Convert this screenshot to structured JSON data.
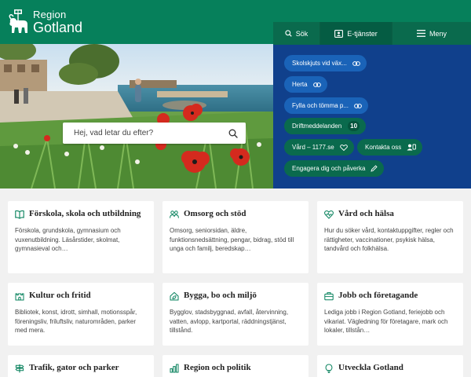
{
  "header": {
    "logo_line1": "Region",
    "logo_line2": "Gotland"
  },
  "nav": {
    "search_label": "Sök",
    "eservices_label": "E-tjänster",
    "menu_label": "Meny"
  },
  "quicklinks": [
    {
      "label": "Skolskjuts vid väx...",
      "icon": "link-icon"
    },
    {
      "label": "Herta",
      "icon": "link-icon"
    },
    {
      "label": "Fylla och tömma p...",
      "icon": "link-icon"
    },
    {
      "label": "Driftmeddelanden",
      "badge": "10"
    },
    {
      "label": "Vård – 1177.se",
      "icon": "link-icon"
    },
    {
      "label": "Kontakta oss",
      "icon": "contact-icon"
    },
    {
      "label": "Engagera dig och påverka",
      "icon": "pencil-icon"
    }
  ],
  "search": {
    "placeholder": "Hej, vad letar du efter?"
  },
  "cards": [
    {
      "title": "Förskola, skola och utbildning",
      "desc": "Förskola, grundskola, gymnasium och vuxenutbildning. Läsårstider, skolmat, gymnasieval och…",
      "icon": "book-icon"
    },
    {
      "title": "Omsorg och stöd",
      "desc": "Omsorg, seniorsidan, äldre, funktionsnedsättning, pengar, bidrag, stöd till unga och familj, beredskap…",
      "icon": "people-icon"
    },
    {
      "title": "Vård och hälsa",
      "desc": "Hur du söker vård, kontaktuppgifter, regler och rättigheter, vaccinationer, psykisk hälsa, tandvård och folkhälsa.",
      "icon": "heart-pulse-icon"
    },
    {
      "title": "Kultur och fritid",
      "desc": "Bibliotek, konst, idrott, simhall, motionsspår, föreningsliv, friluftsliv, naturområden, parker med mera.",
      "icon": "castle-icon"
    },
    {
      "title": "Bygga, bo och miljö",
      "desc": "Bygglov, stadsbyggnad, avfall, återvinning, vatten, avlopp, kartportal, räddningstjänst, tillstånd.",
      "icon": "house-leaf-icon"
    },
    {
      "title": "Jobb och företagande",
      "desc": "Lediga jobb i Region Gotland, feriejobb och vikariat. Vägledning för företagare, mark och lokaler, tillstån…",
      "icon": "briefcase-icon"
    },
    {
      "title": "Trafik, gator och parker",
      "desc": "",
      "icon": "signpost-icon"
    },
    {
      "title": "Region och politik",
      "desc": "",
      "icon": "bar-chart-icon"
    },
    {
      "title": "Utveckla Gotland",
      "desc": "",
      "icon": "lightbulb-icon"
    }
  ],
  "colors": {
    "header_green": "#06805b",
    "panel_blue": "#10408c",
    "chip_blue": "#1a63b8",
    "chip_green": "#0a6a4d",
    "icon_teal": "#06805b"
  }
}
